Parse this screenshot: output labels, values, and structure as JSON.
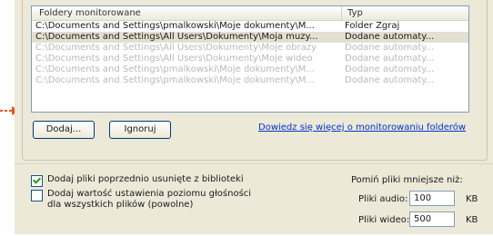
{
  "list": {
    "headers": {
      "folder": "Foldery monitorowane",
      "type": "Typ"
    },
    "rows": [
      {
        "path": "C:\\Documents and Settings\\pmalkowski\\Moje dokumenty\\M...",
        "type": "Folder Zgraj",
        "state": "normal"
      },
      {
        "path": "C:\\Documents and Settings\\All Users\\Dokumenty\\Moja muzy...",
        "type": "Dodane automaty...",
        "state": "selected"
      },
      {
        "path": "C:\\Documents and Settings\\All Users\\Dokumenty\\Moje obrazy",
        "type": "Dodane automaty...",
        "state": "dim"
      },
      {
        "path": "C:\\Documents and Settings\\All Users\\Dokumenty\\Moje wideo",
        "type": "Dodane automaty...",
        "state": "dim"
      },
      {
        "path": "C:\\Documents and Settings\\pmalkowski\\Moje dokumenty\\M...",
        "type": "Dodane automaty...",
        "state": "dim"
      },
      {
        "path": "C:\\Documents and Settings\\pmalkowski\\Moje dokumenty\\M...",
        "type": "Dodane automaty...",
        "state": "dim"
      }
    ]
  },
  "buttons": {
    "add": "Dodaj...",
    "ignore": "Ignoruj"
  },
  "link": "Dowiedz się więcej o monitorowaniu folderów",
  "options": {
    "re_add": {
      "label": "Dodaj pliki poprzednio usunięte z biblioteki",
      "checked": true
    },
    "volume": {
      "label_line1": "Dodaj wartość ustawienia poziomu głośności",
      "label_line2": "dla wszystkich plików (powolne)",
      "checked": false
    }
  },
  "skip": {
    "title": "Pomiń pliki mniejsze niż:",
    "audio_label": "Pliki audio:",
    "audio_value": "100",
    "video_label": "Pliki wideo:",
    "video_value": "500",
    "unit": "KB"
  },
  "colors": {
    "arrow": "#e8551c",
    "link": "#0033cc",
    "check": "#21a121"
  }
}
